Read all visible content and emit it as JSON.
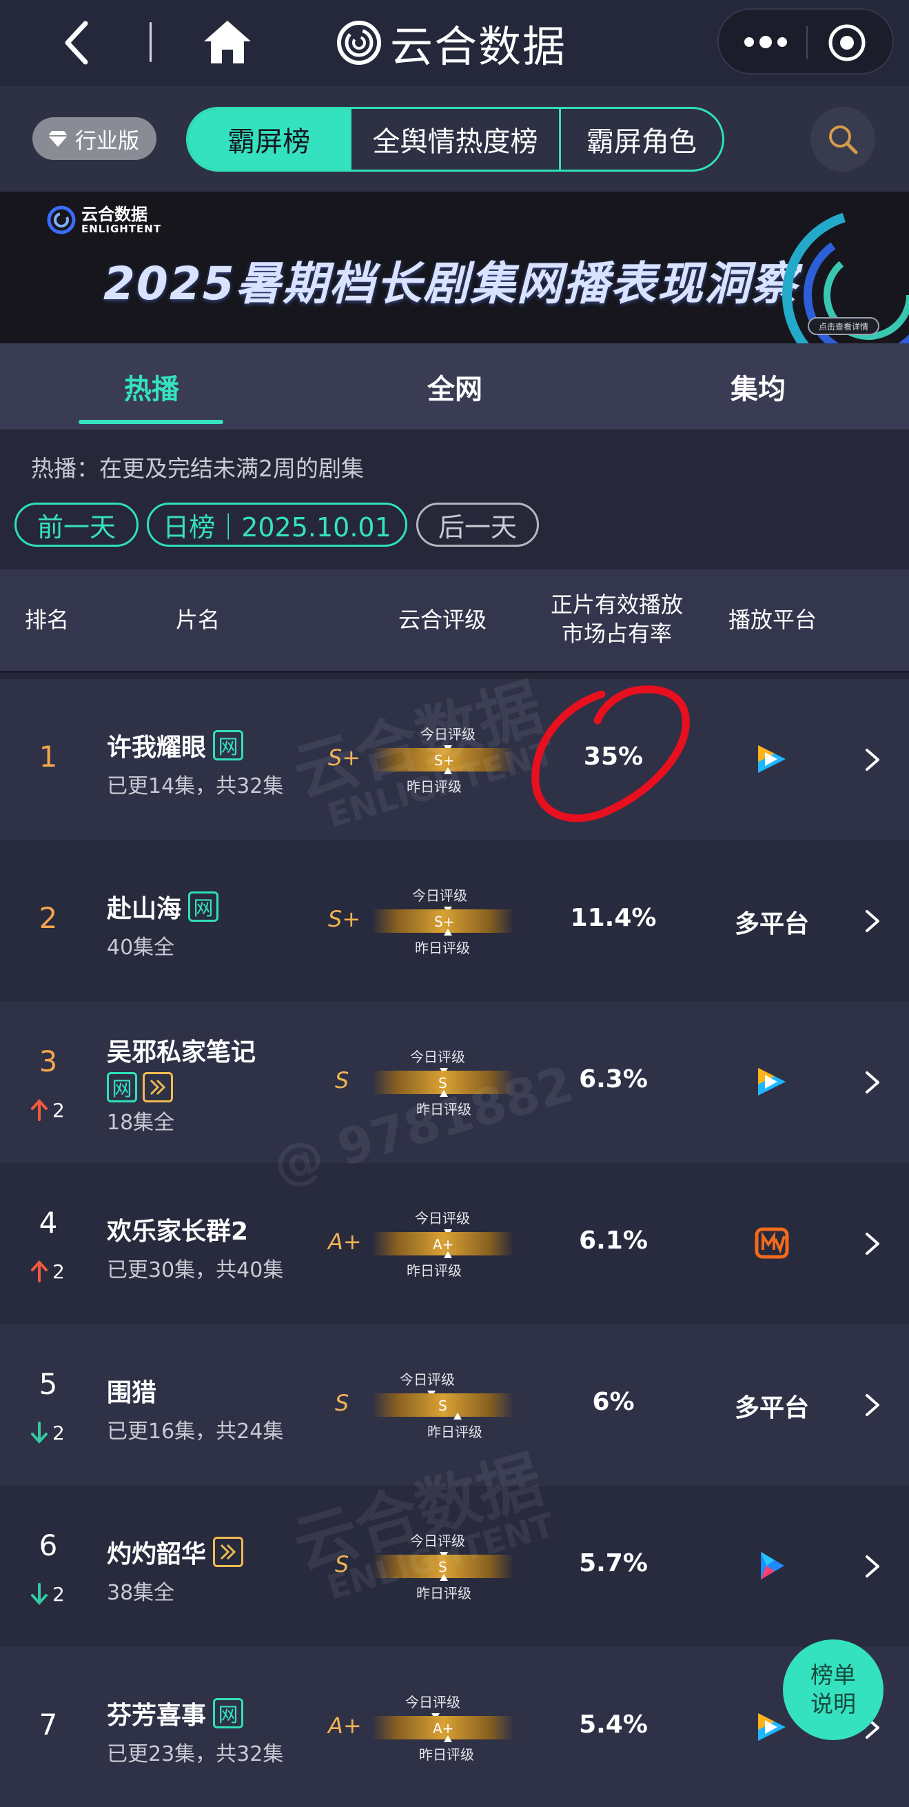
{
  "topbar": {
    "app_title": "云合数据"
  },
  "category_bar": {
    "industry_badge": "行业版",
    "tabs": [
      "霸屏榜",
      "全舆情热度榜",
      "霸屏角色"
    ]
  },
  "banner": {
    "brand_cn": "云合数据",
    "brand_en": "ENLIGHTENT",
    "headline": "2025暑期档长剧集网播表现洞察",
    "cta": "点击查看详情"
  },
  "sub_tabs": [
    "热播",
    "全网",
    "集均"
  ],
  "filter": {
    "description": "热播：在更及完结未满2周的剧集",
    "prev_day": "前一天",
    "date_pill": "日榜｜2025.10.01",
    "next_day": "后一天"
  },
  "table_header": {
    "rank": "排名",
    "title": "片名",
    "rating": "云合评级",
    "share_line1": "正片有效播放",
    "share_line2": "市场占有率",
    "platform": "播放平台"
  },
  "gauge_labels": {
    "today": "今日评级",
    "yesterday": "昨日评级"
  },
  "rows": [
    {
      "rank": "1",
      "title": "许我耀眼",
      "tags": [
        "网"
      ],
      "status": "已更14集，共32集",
      "grade": "S+",
      "gauge": "S+",
      "share": "35%",
      "platform": "tencent-video-icon",
      "delta": ""
    },
    {
      "rank": "2",
      "title": "赴山海",
      "tags": [
        "网"
      ],
      "status": "40集全",
      "grade": "S+",
      "gauge": "S+",
      "share": "11.4%",
      "platform_text": "多平台",
      "delta": ""
    },
    {
      "rank": "3",
      "title": "吴邪私家笔记",
      "tags": [
        "网",
        "play"
      ],
      "status": "18集全",
      "grade": "S",
      "gauge": "S",
      "share": "6.3%",
      "platform": "tencent-video-icon",
      "delta": "2",
      "delta_dir": "up"
    },
    {
      "rank": "4",
      "title": "欢乐家长群2",
      "tags": [],
      "status": "已更30集，共40集",
      "grade": "A+",
      "gauge": "A+",
      "share": "6.1%",
      "platform": "mango-tv-icon",
      "delta": "2",
      "delta_dir": "up"
    },
    {
      "rank": "5",
      "title": "围猎",
      "tags": [],
      "status": "已更16集，共24集",
      "grade": "S",
      "gauge": "S",
      "share": "6%",
      "platform_text": "多平台",
      "delta": "2",
      "delta_dir": "down"
    },
    {
      "rank": "6",
      "title": "灼灼韶华",
      "tags": [
        "play"
      ],
      "status": "38集全",
      "grade": "S",
      "gauge": "S",
      "share": "5.7%",
      "platform": "youku-icon",
      "delta": "2",
      "delta_dir": "down"
    },
    {
      "rank": "7",
      "title": "芬芳喜事",
      "tags": [
        "网"
      ],
      "status": "已更23集，共32集",
      "grade": "A+",
      "gauge": "A+",
      "share": "5.4%",
      "platform": "tencent-video-icon",
      "delta": ""
    }
  ],
  "watermarks": [
    "云合数据",
    "ENLIGHTENT",
    "@ 9781882"
  ],
  "explain_button": {
    "line1": "榜单",
    "line2": "说明"
  },
  "colors": {
    "accent": "#35e2bf",
    "rank_top": "#f4a64a",
    "grade": "#f0b254",
    "annotation": "#e8101e"
  }
}
